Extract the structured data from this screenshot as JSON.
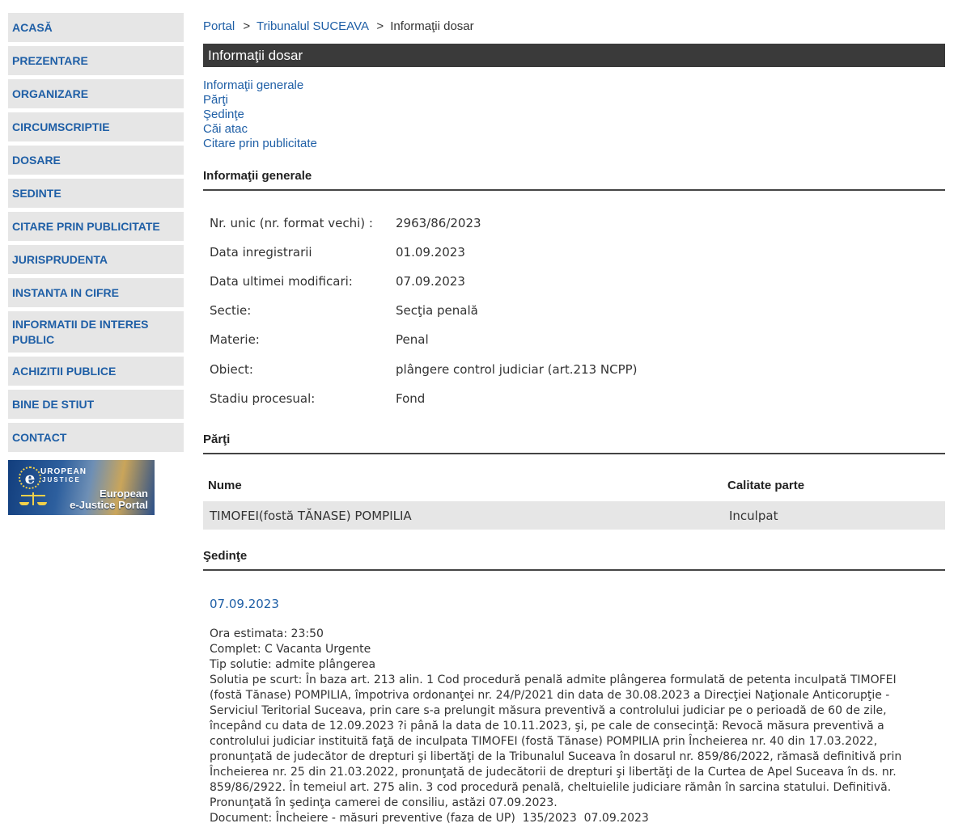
{
  "sidebar": {
    "items": [
      {
        "label": "ACASĂ"
      },
      {
        "label": "PREZENTARE"
      },
      {
        "label": "ORGANIZARE"
      },
      {
        "label": "CIRCUMSCRIPTIE"
      },
      {
        "label": "DOSARE"
      },
      {
        "label": "SEDINTE"
      },
      {
        "label": "CITARE PRIN PUBLICITATE"
      },
      {
        "label": "JURISPRUDENTA"
      },
      {
        "label": "INSTANTA IN CIFRE"
      },
      {
        "label": "INFORMATII DE INTERES PUBLIC"
      },
      {
        "label": "ACHIZITII PUBLICE"
      },
      {
        "label": "BINE DE STIUT"
      },
      {
        "label": "CONTACT"
      }
    ],
    "banner": {
      "badge_letter": "e",
      "top_line1": "UROPEAN",
      "top_line2": "JUSTICE",
      "line1": "European",
      "line2": "e-Justice Portal"
    }
  },
  "breadcrumb": {
    "home": "Portal",
    "sep": ">",
    "court": "Tribunalul SUCEAVA",
    "current": "Informaţii dosar"
  },
  "page_title": "Informaţii dosar",
  "section_links": [
    "Informaţii generale",
    "Părţi",
    "Şedinţe",
    "Căi atac",
    "Citare prin publicitate"
  ],
  "general": {
    "heading": "Informaţii generale",
    "rows": [
      {
        "label": "Nr. unic (nr. format vechi) :",
        "value": "2963/86/2023"
      },
      {
        "label": "Data inregistrarii",
        "value": "01.09.2023"
      },
      {
        "label": "Data ultimei modificari:",
        "value": "07.09.2023"
      },
      {
        "label": "Sectie:",
        "value": "Secţia penală"
      },
      {
        "label": "Materie:",
        "value": "Penal"
      },
      {
        "label": "Obiect:",
        "value": "plângere control judiciar (art.213 NCPP)"
      },
      {
        "label": "Stadiu procesual:",
        "value": "Fond"
      }
    ]
  },
  "parties": {
    "heading": "Părţi",
    "col_name": "Nume",
    "col_role": "Calitate parte",
    "rows": [
      {
        "name": "TIMOFEI(fostă TĂNASE) POMPILIA",
        "role": "Inculpat"
      }
    ]
  },
  "hearings": {
    "heading": "Şedinţe",
    "date": "07.09.2023",
    "lines": [
      "Ora estimata: 23:50",
      "Complet: C Vacanta Urgente",
      "Tip solutie: admite plângerea",
      "Solutia pe scurt: În baza art. 213 alin. 1 Cod procedură penală admite plângerea formulată de petenta inculpată TIMOFEI",
      "(fostă Tănase) POMPILIA, împotriva ordonanţei nr. 24/P/2021 din data de 30.08.2023 a Direcţiei Naţionale Anticorupţie -",
      "Serviciul Teritorial Suceava, prin care s-a prelungit măsura preventivă a controlului judiciar pe o perioadă de 60 de zile,",
      "începând cu data de 12.09.2023 ?i până la data de 10.11.2023, şi, pe cale de consecinţă: Revocă măsura preventivă a",
      "controlului judiciar instituită faţă de inculpata TIMOFEI (fostă Tănase) POMPILIA prin Încheierea nr. 40 din 17.03.2022,",
      "pronunţată de judecător de drepturi şi libertăţi de la Tribunalul Suceava în dosarul nr. 859/86/2022, rămasă definitivă prin",
      "Încheierea nr. 25 din 21.03.2022, pronunţată de judecătorii de drepturi şi libertăţi de la Curtea de Apel Suceava în ds. nr.",
      "859/86/2922. În temeiul art. 275 alin. 3 cod procedură penală, cheltuielile judiciare rămân în sarcina statului. Definitivă.",
      "Pronunţată în şedinţa camerei de consiliu, astăzi 07.09.2023.",
      "Document: Încheiere - măsuri preventive (faza de UP)  135/2023  07.09.2023"
    ]
  }
}
